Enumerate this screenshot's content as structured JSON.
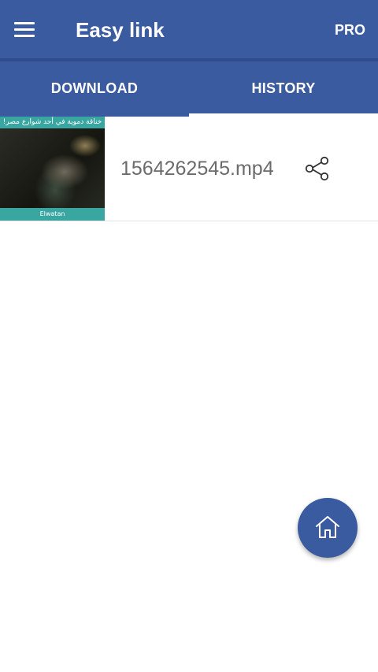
{
  "toolbar": {
    "title": "Easy link",
    "pro_label": "PRO",
    "menu_icon": "hamburger-menu-icon",
    "background_color": "#3a5ba0"
  },
  "tabs": [
    {
      "label": "DOWNLOAD",
      "selected": false
    },
    {
      "label": "HISTORY",
      "selected": true
    }
  ],
  "history": {
    "items": [
      {
        "file_name": "1564262545.mp4",
        "thumbnail_caption": "خناقة دموية في أحد شوارع مصر!",
        "thumbnail_watermark": "Elwatan",
        "action_icon": "share-icon"
      }
    ]
  },
  "fab": {
    "icon": "home-icon",
    "color": "#3a5ba0"
  }
}
